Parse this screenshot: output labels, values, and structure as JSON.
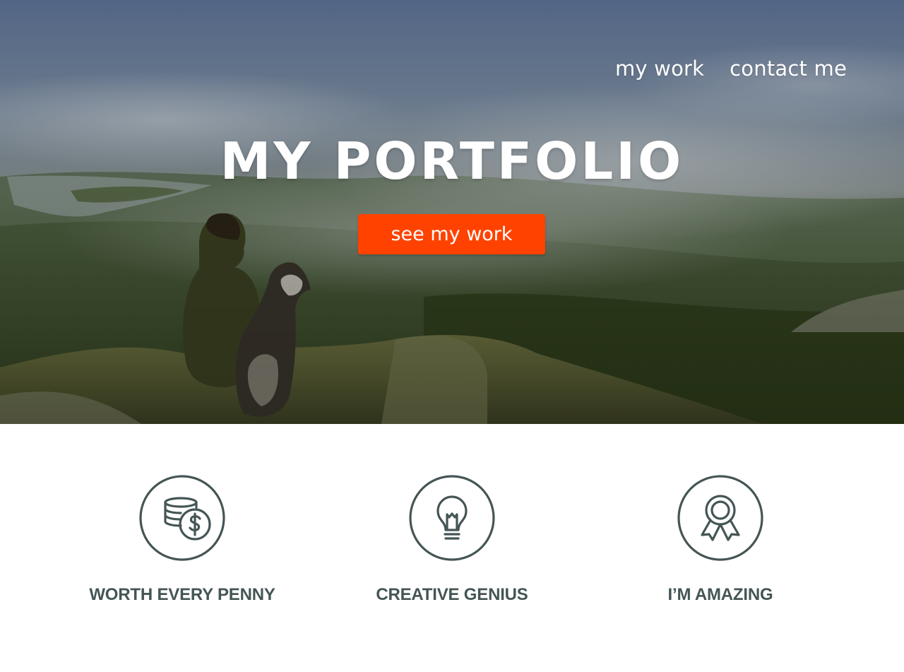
{
  "colors": {
    "accent": "#ff4200",
    "icon_stroke": "#455555",
    "feature_text": "#455555",
    "hero_text": "#ffffff"
  },
  "nav": {
    "items": [
      {
        "label": "my work"
      },
      {
        "label": "contact me"
      }
    ]
  },
  "hero": {
    "title": "MY PORTFOLIO",
    "cta_label": "see my work",
    "background": "foggy mountain landscape photo with person and husky dog sitting on rocky summit"
  },
  "features": [
    {
      "icon": "coins-icon",
      "label": "WORTH EVERY PENNY"
    },
    {
      "icon": "lightbulb-icon",
      "label": "CREATIVE GENIUS"
    },
    {
      "icon": "award-ribbon-icon",
      "label": "I’M AMAZING"
    }
  ]
}
